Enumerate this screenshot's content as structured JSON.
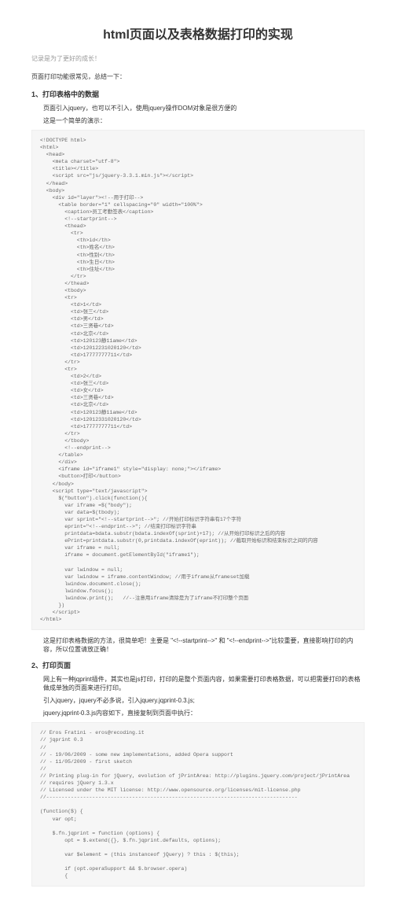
{
  "title": "html页面以及表格数据打印的实现",
  "subtitle": "记录是为了更好的成长！",
  "intro": "页面打印功能很常见，总结一下：",
  "section1": {
    "head": "1、打印表格中的数据",
    "line1": "页面引入jquery，也可以不引入，使用jquery操作DOM对象是很方便的",
    "line2": "这是一个简单的演示：",
    "code": "<!DOCTYPE html>\n<html>\n  <head>\n    <meta charset=\"utf-8\">\n    <title></title>\n    <script src=\"js/jquery-3.3.1.min.js\"></script>\n  </head>\n  <body>\n    <div id=\"layer\"><!--用于打印-->\n      <table border=\"1\" cellspacing=\"0\" width=\"100%\">\n        <caption>员工考勤签表</caption>\n        <!--startprint-->\n        <thead>\n          <tr>\n            <th>id</th>\n            <th>姓名</th>\n            <th>性别</th>\n            <th>生日</th>\n            <th>住址</th>\n          </tr>\n        </thead>\n        <tbody>\n        <tr>\n          <td>1</td>\n          <td>张三</td>\n          <td>男</td>\n          <td>三贤巷</td>\n          <td>北京</td>\n          <td>120123静11ame</td>\n          <td>12012231020120</td>\n          <td>17777777711</td>\n        </tr>\n        <tr>\n          <td>2</td>\n          <td>张三</td>\n          <td>女</td>\n          <td>三贤巷</td>\n          <td>北京</td>\n          <td>120123静11ame</td>\n          <td>12012331020120</td>\n          <td>17777777711</td>\n        </tr>\n        </tbody>\n        <!--endprint-->\n      </table>\n      </div>\n      <iframe id=\"iframe1\" style=\"display: none;\"></iframe>\n      <button>打印</button>\n    </body>\n    <script type=\"text/javascript\">\n      $(\"button\").click(function(){\n        var iframe =$(\"body\");\n        var data=$(tbody);\n        var sprint=\"<!--startprint-->\"; //开始打印标识字符串有17个字符\n        eprint=\"<!--endprint-->\"; //结束打印标识字符串\n        printdata=bdata.substr(bdata.indexOf(sprint)+17); //从开始打印标识之后的内容\n        ePrint=printdata.substr(0,printdata.indexOf(eprint)); //截取开始标识和结束标识之间的内容\n        var iframe = null;\n        iframe = document.getElementById(\"iframe1\");\n\n        var lwindow = null;\n        var lwindow = iframe.contentWindow; //用于iframe从frameset加载\n        lwindow.document.close();\n        lwindow.focus();\n        lwindow.print();   //--注意用iframe清除是为了iframe不打印整个页面\n      })\n    </script>\n</html>",
    "note": "这是打印表格数据的方法，很简单吧！主要是 \"<!--startprint-->\" 和 \"<!--endprint-->\"比较重要，直接影响打印的内容，所以位置请放正确！"
  },
  "section2": {
    "head": "2、打印页面",
    "line1": "网上有一种jqprint插件，其实也是js打印，打印的是整个页面内容，如果需要打印表格数据，可以把需要打印的表格做成单独的页面来进行打印。",
    "line2": "引入jquery，jquery不必多说，引入jquery.jqprint-0.3.js;",
    "line3": "jquery.jqprint-0.3.js内容如下，直接复制到页面中执行：",
    "code": "// Eros Fratini - eros@recoding.it\n// jqprint 0.3\n//\n// - 19/06/2009 - some new implementations, added Opera support\n// - 11/05/2009 - first sketch\n//\n// Printing plug-in for jQuery, evolution of jPrintArea: http://plugins.jquery.com/project/jPrintArea\n// requires jQuery 1.3.x\n// Licensed under the MIT license: http://www.opensource.org/licenses/mit-license.php\n//----------------------------------------------------------------------------------\n\n(function($) {\n    var opt;\n\n    $.fn.jqprint = function (options) {\n        opt = $.extend({}, $.fn.jqprint.defaults, options);\n\n        var $element = (this instanceof jQuery) ? this : $(this);\n\n        if (opt.operaSupport && $.browser.opera)\n        {"
  }
}
